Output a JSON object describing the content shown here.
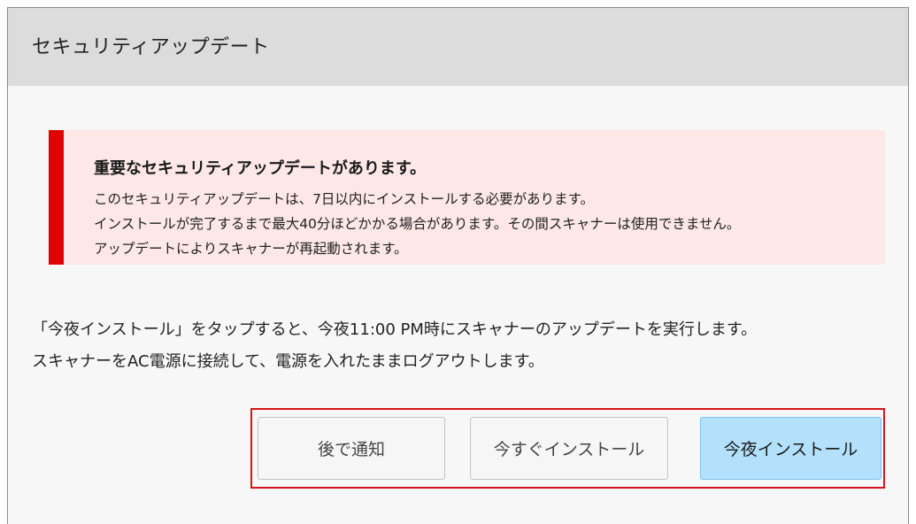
{
  "dialog": {
    "title": "セキュリティアップデート"
  },
  "alert": {
    "heading": "重要なセキュリティアップデートがあります。",
    "lines": [
      "このセキュリティアップデートは、7日以内にインストールする必要があります。",
      "インストールが完了するまで最大40分ほどかかる場合があります。その間スキャナーは使用できません。",
      "アップデートによりスキャナーが再起動されます。"
    ],
    "accent_color": "#e00000",
    "background_color": "#fde7e7"
  },
  "instructions": {
    "lines": [
      "「今夜インストール」をタップすると、今夜11:00 PM時にスキャナーのアップデートを実行します。",
      "スキャナーをAC電源に接続して、電源を入れたままログアウトします。"
    ]
  },
  "buttons": {
    "later": "後で通知",
    "install_now": "今すぐインストール",
    "install_tonight": "今夜インストール",
    "highlight_border_color": "#d6141c",
    "primary_color": "#b3e0fb"
  }
}
